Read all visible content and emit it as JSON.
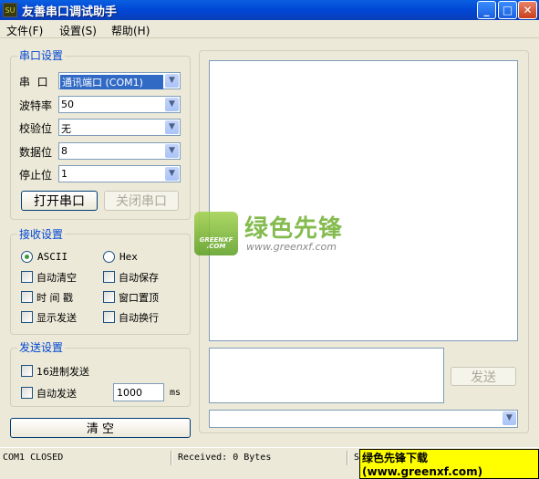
{
  "window": {
    "title": "友善串口调试助手",
    "icon": "SU"
  },
  "menu": [
    "文件(F)",
    "设置(S)",
    "帮助(H)"
  ],
  "serial": {
    "title": "串口设置",
    "fields": [
      {
        "label": "串  口",
        "value": "通讯端口 (COM1)"
      },
      {
        "label": "波特率",
        "value": "50"
      },
      {
        "label": "校验位",
        "value": "无"
      },
      {
        "label": "数据位",
        "value": "8"
      },
      {
        "label": "停止位",
        "value": "1"
      }
    ],
    "open": "打开串口",
    "close": "关闭串口"
  },
  "receive": {
    "title": "接收设置",
    "ascii": "ASCII",
    "hex": "Hex",
    "mode": "ASCII",
    "options": [
      "自动清空",
      "自动保存",
      "时 间 戳",
      "窗口置顶",
      "显示发送",
      "自动换行"
    ]
  },
  "send": {
    "title": "发送设置",
    "hex_send": "16进制发送",
    "auto_send": "自动发送",
    "interval": "1000",
    "unit": "ms",
    "send_button": "发送"
  },
  "clear": "清 空",
  "status": {
    "port": "COM1 CLOSED",
    "received": "Received: 0 Bytes",
    "sent": "S"
  },
  "watermark": {
    "brand": "绿色先锋",
    "url": "www.greenxf.com",
    "logo_text": "GREENXF .COM",
    "banner": "绿色先锋下载(www.greenxf.com)"
  }
}
